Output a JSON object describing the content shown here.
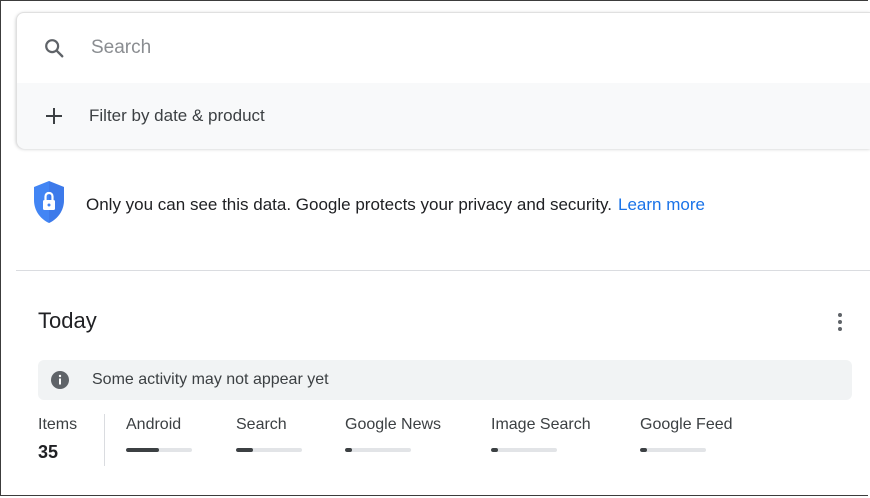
{
  "search": {
    "placeholder": "Search",
    "icon": "search-icon"
  },
  "filter": {
    "label": "Filter by date & product",
    "icon": "plus-icon"
  },
  "privacy": {
    "text": "Only you can see this data. Google protects your privacy and security.",
    "link_label": "Learn more",
    "icon": "shield-lock-icon",
    "shield_color": "#4285f4"
  },
  "today": {
    "title": "Today",
    "menu_icon": "more-vert-icon",
    "notice": {
      "text": "Some activity may not appear yet",
      "icon": "info-icon"
    },
    "stats": {
      "items_label": "Items",
      "items_count": "35",
      "products": [
        {
          "label": "Android",
          "share": 0.5
        },
        {
          "label": "Search",
          "share": 0.25
        },
        {
          "label": "Google News",
          "share": 0.1
        },
        {
          "label": "Image Search",
          "share": 0.1
        },
        {
          "label": "Google Feed",
          "share": 0.1
        }
      ]
    }
  },
  "colors": {
    "link": "#1a73e8",
    "text": "#202124",
    "bar_fill": "#3c4043",
    "bar_track": "#e2e4e7"
  }
}
